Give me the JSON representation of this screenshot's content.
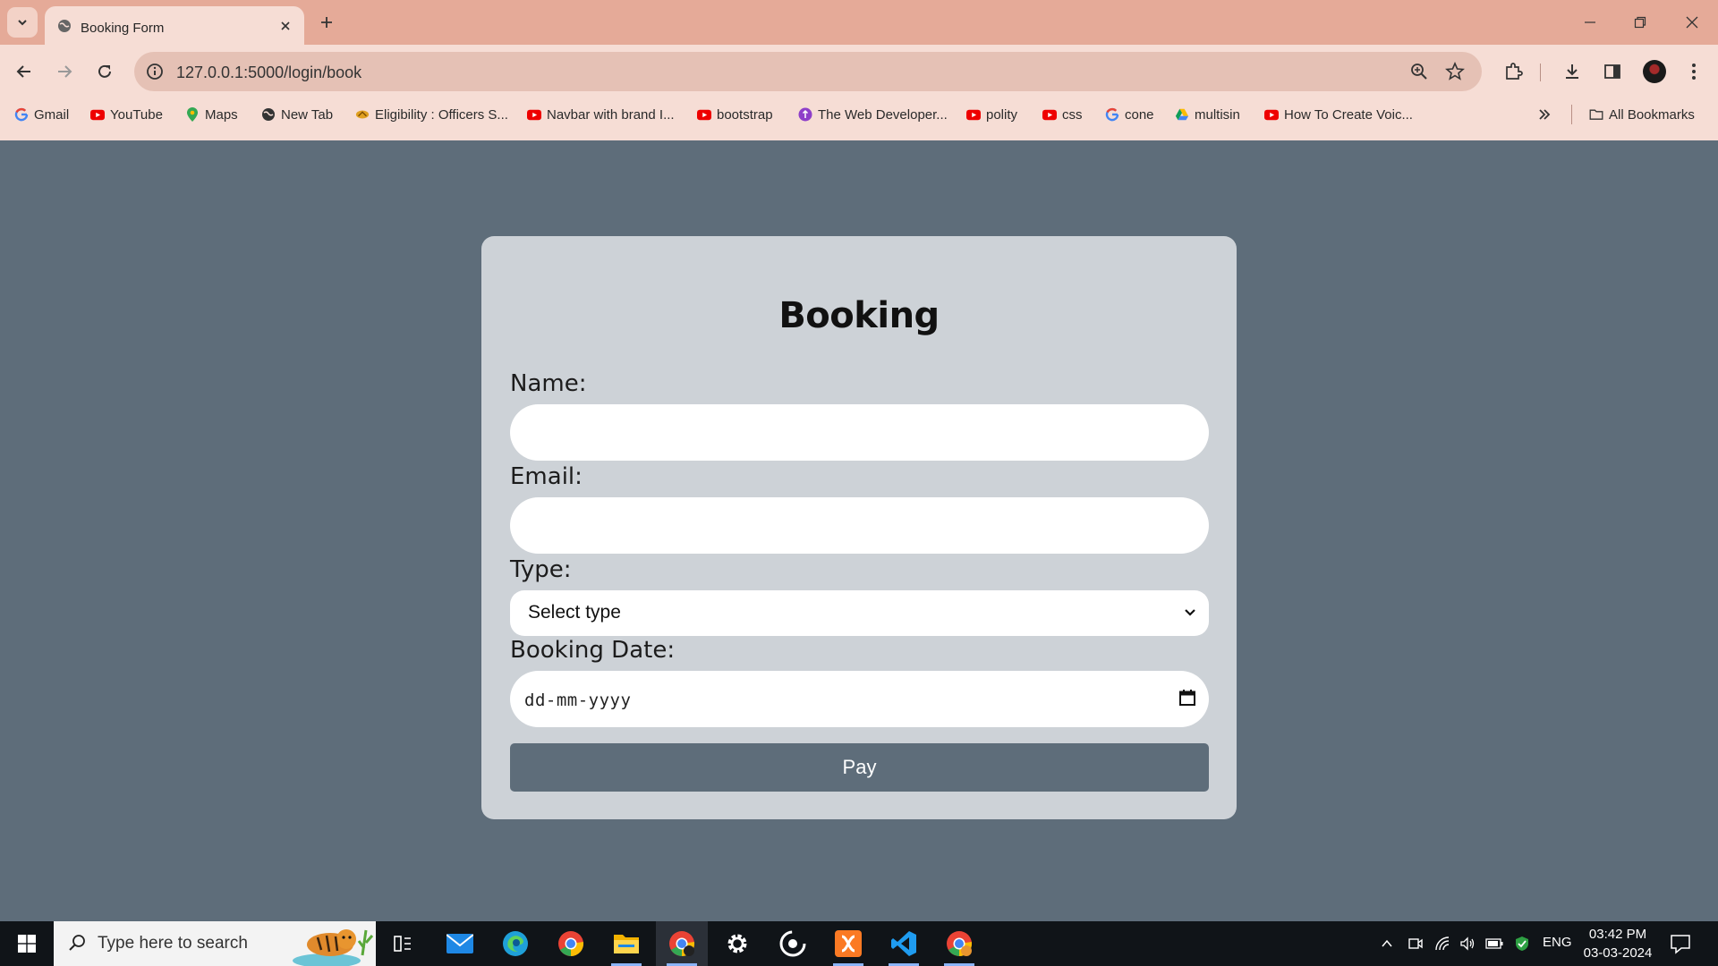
{
  "browser": {
    "tab": {
      "title": "Booking Form"
    },
    "address": {
      "url": "127.0.0.1:5000/login/book"
    },
    "bookmarks": [
      {
        "label": "Gmail",
        "icon": "google-icon"
      },
      {
        "label": "YouTube",
        "icon": "youtube-icon"
      },
      {
        "label": "Maps",
        "icon": "maps-icon"
      },
      {
        "label": "New Tab",
        "icon": "globe-icon"
      },
      {
        "label": "Eligibility : Officers S...",
        "icon": "site-icon"
      },
      {
        "label": "Navbar with brand I...",
        "icon": "youtube-icon"
      },
      {
        "label": "bootstrap",
        "icon": "youtube-icon"
      },
      {
        "label": "The Web Developer...",
        "icon": "site-icon"
      },
      {
        "label": "polity",
        "icon": "youtube-icon"
      },
      {
        "label": "css",
        "icon": "youtube-icon"
      },
      {
        "label": "cone",
        "icon": "google-icon"
      },
      {
        "label": "multisin",
        "icon": "drive-icon"
      },
      {
        "label": "How To Create Voic...",
        "icon": "youtube-icon"
      }
    ],
    "all_bookmarks_label": "All Bookmarks"
  },
  "form": {
    "title": "Booking",
    "name_label": "Name:",
    "name_value": "",
    "email_label": "Email:",
    "email_value": "",
    "type_label": "Type:",
    "type_selected": "Select type",
    "date_label": "Booking Date:",
    "date_placeholder": "dd-mm-yyyy",
    "submit_label": "Pay"
  },
  "taskbar": {
    "search_placeholder": "Type here to search",
    "language": "ENG",
    "time": "03:42 PM",
    "date": "03-03-2024"
  },
  "colors": {
    "page_background": "#5e6d7a",
    "card_background": "#cdd2d7",
    "button_background": "#5e6d7a",
    "browser_frame": "#e5aa98",
    "browser_toolbar": "#f6ddd5"
  }
}
